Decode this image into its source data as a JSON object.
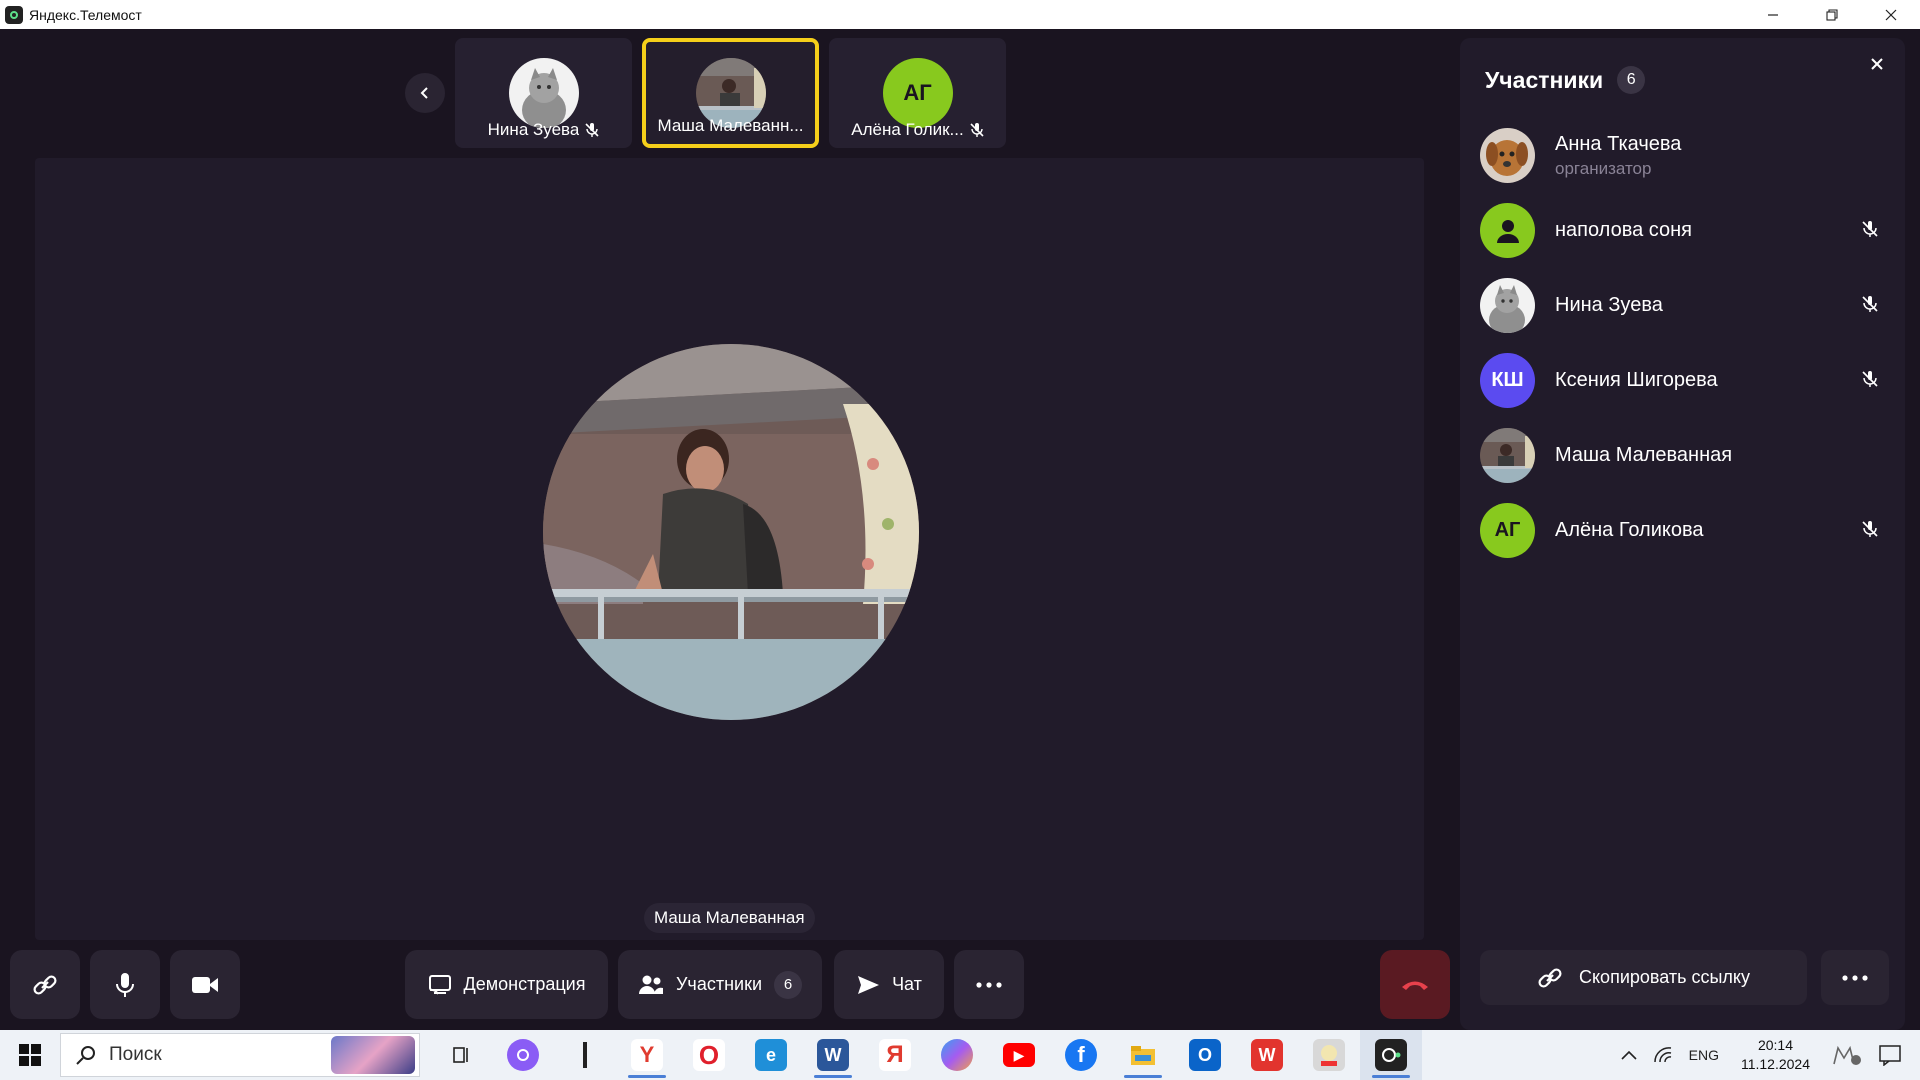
{
  "window": {
    "title": "Яндекс.Телемост"
  },
  "thumbnails": [
    {
      "name": "Нина Зуева",
      "muted": true,
      "avatar": "cat-photo"
    },
    {
      "name": "Маша Малеванн...",
      "muted": false,
      "avatar": "person-photo",
      "active": true
    },
    {
      "name": "Алёна Голик...",
      "muted": true,
      "avatar": "initials",
      "initials": "АГ",
      "color": "#88c91e"
    }
  ],
  "stage": {
    "speaker_name": "Маша Малеванная"
  },
  "controls": {
    "demo_label": "Демонстрация",
    "participants_label": "Участники",
    "participants_count": "6",
    "chat_label": "Чат"
  },
  "panel": {
    "title": "Участники",
    "count": "6",
    "participants": [
      {
        "name": "Анна Ткачева",
        "role": "организатор",
        "avatar": "dog-photo",
        "muted": false
      },
      {
        "name": "наполова соня",
        "role": "",
        "avatar": "default-user",
        "color": "#88c91e",
        "muted": true
      },
      {
        "name": "Нина Зуева",
        "role": "",
        "avatar": "cat-photo",
        "muted": true
      },
      {
        "name": "Ксения Шигорева",
        "role": "",
        "avatar": "initials",
        "initials": "КШ",
        "color": "#5b4bf0",
        "muted": true
      },
      {
        "name": "Маша Малеванная",
        "role": "",
        "avatar": "person-photo",
        "muted": false
      },
      {
        "name": "Алёна Голикова",
        "role": "",
        "avatar": "initials",
        "initials": "АГ",
        "color": "#88c91e",
        "muted": true
      }
    ],
    "copy_link_label": "Скопировать ссылку"
  },
  "taskbar": {
    "search_label": "Поиск",
    "language": "ENG",
    "time": "20:14",
    "date": "11.12.2024",
    "apps": [
      {
        "name": "task-view-icon",
        "color": "transparent",
        "glyph": ""
      },
      {
        "name": "alice-icon",
        "color": "#8a5cf5",
        "glyph": ""
      },
      {
        "name": "separator-icon",
        "color": "transparent",
        "glyph": ""
      },
      {
        "name": "yandex-browser-icon",
        "color": "#ffffff",
        "glyph": "Y",
        "running": true
      },
      {
        "name": "opera-icon",
        "color": "#ffffff",
        "glyph": "O"
      },
      {
        "name": "edge-icon",
        "color": "#1f8fd8",
        "glyph": "e"
      },
      {
        "name": "word-icon",
        "color": "#2b579a",
        "glyph": "W",
        "running": true
      },
      {
        "name": "yandex-icon",
        "color": "#ffffff",
        "glyph": "Я"
      },
      {
        "name": "copilot-icon",
        "color": "#7c6cf0",
        "glyph": ""
      },
      {
        "name": "youtube-icon",
        "color": "#ff0000",
        "glyph": "▶"
      },
      {
        "name": "facebook-icon",
        "color": "#1877f2",
        "glyph": "f"
      },
      {
        "name": "file-explorer-icon",
        "color": "#f3c033",
        "glyph": "",
        "running": true
      },
      {
        "name": "outlook-icon",
        "color": "#0a64c9",
        "glyph": "O"
      },
      {
        "name": "wps-icon",
        "color": "#e2342e",
        "glyph": "W"
      },
      {
        "name": "pdf24-icon",
        "color": "#d8d8d8",
        "glyph": ""
      },
      {
        "name": "telemost-icon",
        "color": "#222222",
        "glyph": "",
        "running": true,
        "current": true
      }
    ]
  }
}
